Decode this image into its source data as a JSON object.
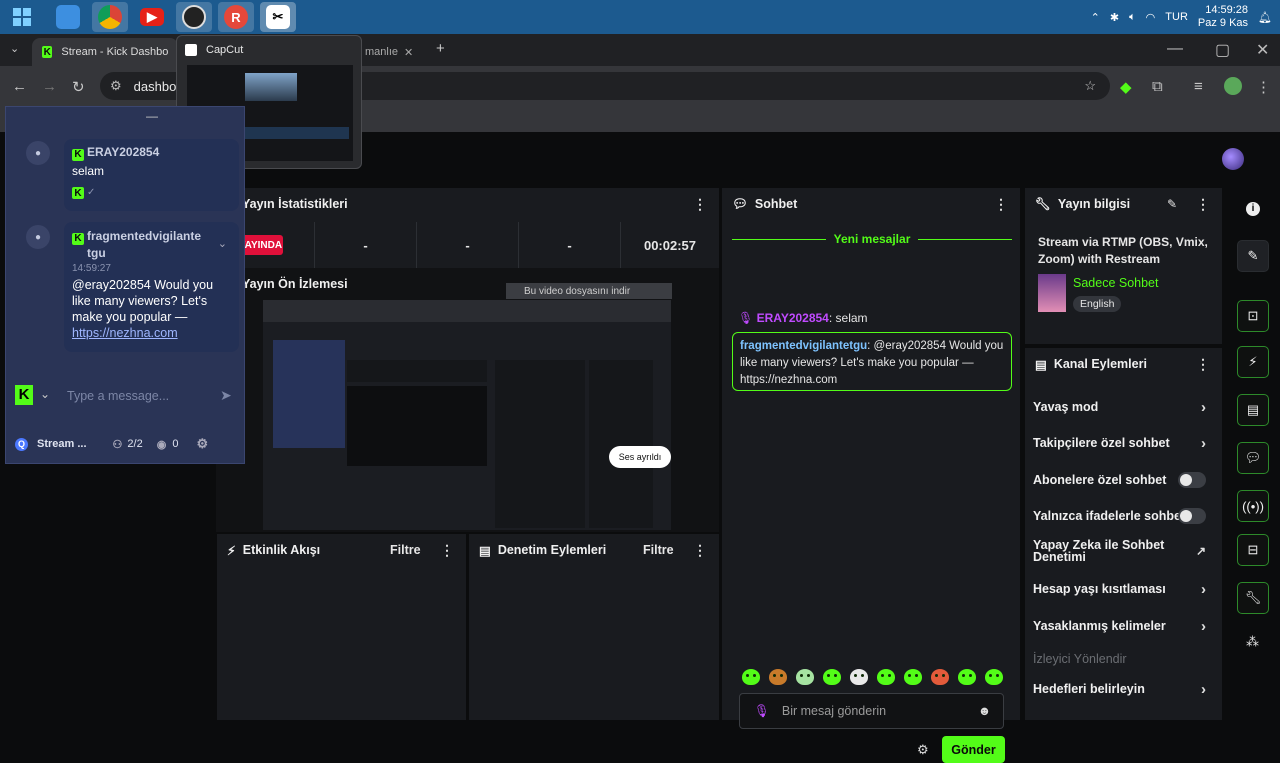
{
  "taskbar": {
    "time": "14:59:28",
    "date": "Paz 9 Kas",
    "lang": "TUR"
  },
  "browser": {
    "tabs": [
      {
        "label": "Stream - Kick Dashboard"
      },
      {
        "label": "manlıe"
      }
    ],
    "thumbnail_title": "CapCut",
    "url": "dashboa"
  },
  "popup_chat": {
    "minimize": "—",
    "messages": [
      {
        "user": "ERAY202854",
        "text": "selam"
      },
      {
        "user": "fragmentedvigilante",
        "user_line2": "tgu",
        "time": "14:59:27",
        "text": "@eray202854 Would you like many viewers? Let's make you popular —",
        "link": "https://nezhna.com"
      }
    ],
    "input_placeholder": "Type a message...",
    "footer_title": "Stream ...",
    "footer_count": "2/2",
    "footer_views": "0"
  },
  "stats": {
    "title": "Yayın İstatistikleri",
    "live": "YAYINDA",
    "v1": "-",
    "v2": "-",
    "v3": "-",
    "timer": "00:02:57"
  },
  "preview": {
    "title": "Yayın Ön İzlemesi",
    "download": "Bu video dosyasını indir",
    "sound_badge": "Ses ayrıldı"
  },
  "activity": {
    "title": "Etkinlik Akışı",
    "filter": "Filtre"
  },
  "moderation": {
    "title": "Denetim Eylemleri",
    "filter": "Filtre"
  },
  "chat": {
    "title": "Sohbet",
    "new_messages": "Yeni mesajlar",
    "msg1_user": "ERAY202854",
    "msg1_text": ": selam",
    "msg2_user": "fragmentedvigilantetgu",
    "msg2_text": ": @eray202854 Would you like many viewers? Let's make you popular — https://nezhna.com",
    "input_placeholder": "Bir mesaj gönderin",
    "send": "Gönder"
  },
  "info": {
    "title": "Yayın bilgisi",
    "stream_title": "Stream via RTMP (OBS, Vmix, Zoom) with Restream",
    "category": "Sadece Sohbet",
    "language": "English"
  },
  "actions": {
    "title": "Kanal Eylemleri",
    "items": [
      "Yavaş mod",
      "Takipçilere özel sohbet",
      "Abonelere özel sohbet",
      "Yalnızca ifadelerle sohbet",
      "Yapay Zeka ile Sohbet Denetimi",
      "Hesap yaşı kısıtlaması",
      "Yasaklanmış kelimeler",
      "İzleyici Yönlendir",
      "Hedefleri belirleyin"
    ]
  },
  "colors": {
    "accent": "#53fc18",
    "live": "#e0103a",
    "chat_user": "#c04bff",
    "panel": "#191b1f"
  }
}
